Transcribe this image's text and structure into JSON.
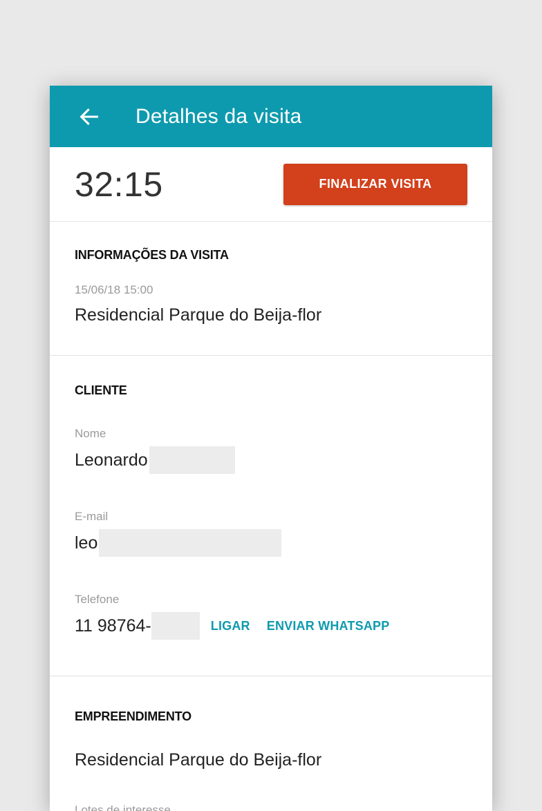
{
  "header": {
    "title": "Detalhes da visita",
    "back_icon": "arrow-left-icon"
  },
  "timer": {
    "value": "32:15",
    "finish_label": "FINALIZAR VISITA"
  },
  "visit_info": {
    "title": "INFORMAÇÕES DA VISITA",
    "datetime": "15/06/18 15:00",
    "place": "Residencial Parque do Beija-flor"
  },
  "client": {
    "title": "CLIENTE",
    "name_label": "Nome",
    "name_value": "Leonardo",
    "email_label": "E-mail",
    "email_value": "leo",
    "phone_label": "Telefone",
    "phone_value": "11 98764-",
    "call_label": "LIGAR",
    "whatsapp_label": "ENVIAR WHATSAPP"
  },
  "development": {
    "title": "EMPREENDIMENTO",
    "name": "Residencial Parque do Beija-flor",
    "lots_label": "Lotes de interesse"
  },
  "colors": {
    "primary": "#0e9aae",
    "accent": "#d2401c",
    "background": "#e9e9e9"
  }
}
